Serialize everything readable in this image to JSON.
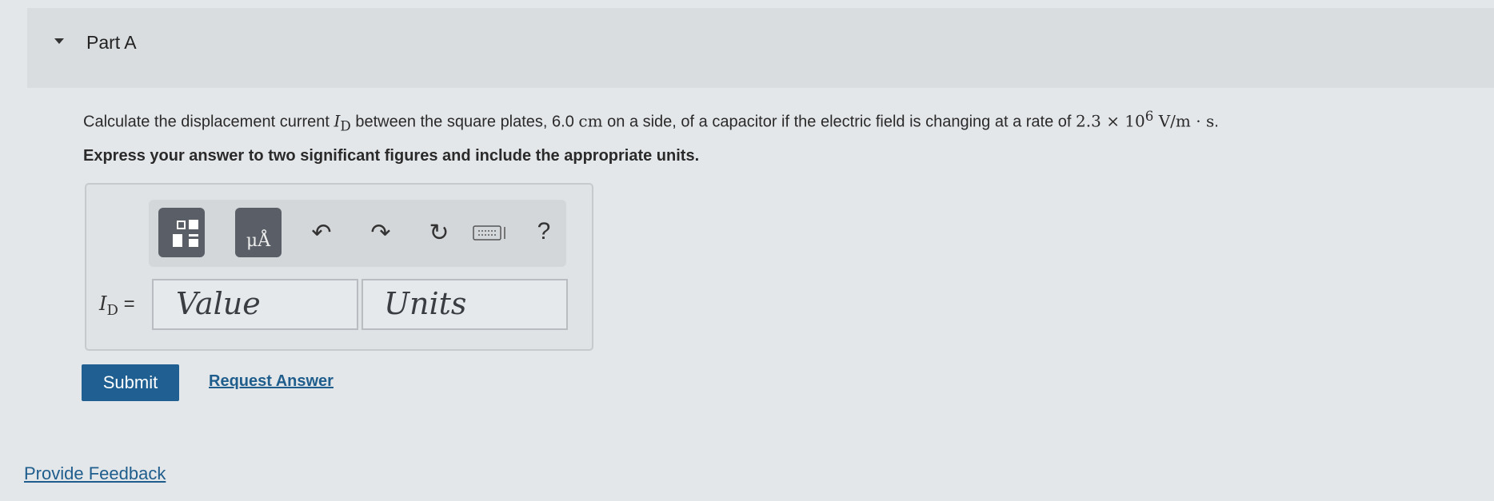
{
  "part": {
    "title": "Part A"
  },
  "question": {
    "text_before": "Calculate the displacement current ",
    "symbol": "I",
    "symbol_sub": "D",
    "text_mid": " between the square plates, 6.0  ",
    "unit_cm": "cm",
    "text_after": " on a side, of a capacitor if the electric field is changing at a rate of ",
    "rate_coef": "2.3 × 10",
    "rate_exp": "6",
    "rate_unit": " V/m · s",
    "end": "."
  },
  "instruction": "Express your answer to two significant figures and include the appropriate units.",
  "toolbar": {
    "units_glyph": "μÅ",
    "undo_glyph": "↶",
    "redo_glyph": "↷",
    "reset_glyph": "↻",
    "help_label": "?"
  },
  "answer": {
    "label": "I",
    "label_sub": "D",
    "equals": " =",
    "value_placeholder": "Value",
    "units_placeholder": "Units"
  },
  "actions": {
    "submit_label": "Submit",
    "request_label": "Request Answer"
  },
  "footer": {
    "feedback_label": "Provide Feedback"
  }
}
